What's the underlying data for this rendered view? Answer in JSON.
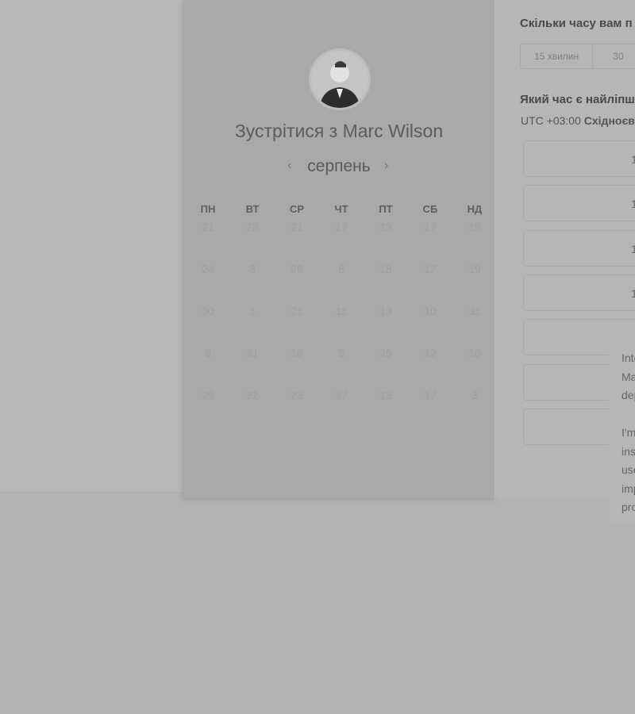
{
  "host": {
    "title": "Зустрітися з Marc Wilson",
    "month": "серпень",
    "prev": "‹",
    "next": "›"
  },
  "calendar": {
    "weekdays": [
      "ПН",
      "ВТ",
      "СР",
      "ЧТ",
      "ПТ",
      "СБ",
      "НД"
    ],
    "days": [
      "21",
      "28",
      "21",
      "17",
      "13",
      "17",
      "15",
      "24",
      "3",
      "26",
      "6",
      "18",
      "17",
      "19",
      "30",
      "1",
      "21",
      "11",
      "13",
      "10",
      "31",
      "9",
      "31",
      "18",
      "5",
      "25",
      "12",
      "10",
      "29",
      "22",
      "23",
      "27",
      "13",
      "17",
      "3"
    ]
  },
  "duration": {
    "question": "Скільки часу вам п",
    "options": [
      "15 хвилин",
      "30"
    ]
  },
  "time": {
    "question": "Який час є найліпш",
    "tz_offset": "UTC +03:00",
    "tz_name": "Східноєв",
    "slots": [
      "1",
      "1",
      "1",
      "1",
      "",
      "",
      ""
    ]
  },
  "popup": {
    "lines": [
      "Inte",
      "Ma",
      "dep",
      "",
      "I'm",
      "ins",
      "use",
      "imp",
      "pro"
    ]
  }
}
